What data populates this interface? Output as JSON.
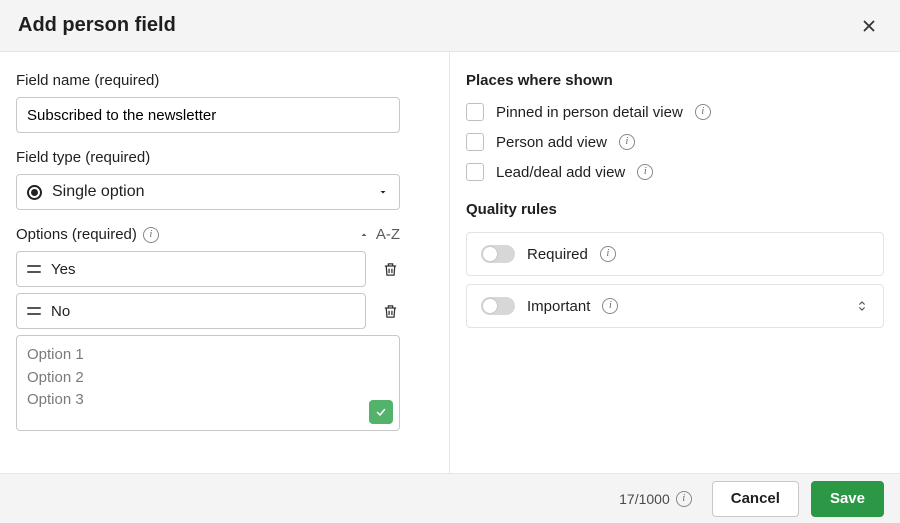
{
  "header": {
    "title": "Add person field"
  },
  "left": {
    "field_name_label": "Field name (required)",
    "field_name_value": "Subscribed to the newsletter",
    "field_type_label": "Field type (required)",
    "field_type_value": "Single option",
    "options_label": "Options (required)",
    "sort_label": "A-Z",
    "options": [
      {
        "value": "Yes"
      },
      {
        "value": "No"
      }
    ],
    "bulk_placeholder_lines": [
      "Option 1",
      "Option 2",
      "Option 3"
    ]
  },
  "right": {
    "places_title": "Places where shown",
    "places": [
      {
        "label": "Pinned in person detail view",
        "checked": false,
        "info": true
      },
      {
        "label": "Person add view",
        "checked": false,
        "info": true
      },
      {
        "label": "Lead/deal add view",
        "checked": false,
        "info": true
      }
    ],
    "quality_title": "Quality rules",
    "rules": [
      {
        "label": "Required",
        "on": false,
        "info": true,
        "expandable": false
      },
      {
        "label": "Important",
        "on": false,
        "info": true,
        "expandable": true
      }
    ]
  },
  "footer": {
    "char_count": "17/1000",
    "cancel": "Cancel",
    "save": "Save"
  }
}
